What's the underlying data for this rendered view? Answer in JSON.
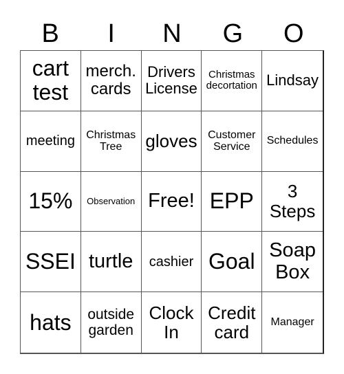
{
  "header": {
    "letters": [
      "B",
      "I",
      "N",
      "G",
      "O"
    ]
  },
  "cells": [
    "cart test",
    "merch. cards",
    "Drivers License",
    "Christmas decortation",
    "Lindsay",
    "meeting",
    "Christmas Tree",
    "gloves",
    "Customer Service",
    "Schedules",
    "15%",
    "Observation",
    "Free!",
    "EPP",
    "3 Steps",
    "SSEI",
    "turtle",
    "cashier",
    "Goal",
    "Soap Box",
    "hats",
    "outside garden",
    "Clock In",
    "Credit card",
    "Manager"
  ]
}
